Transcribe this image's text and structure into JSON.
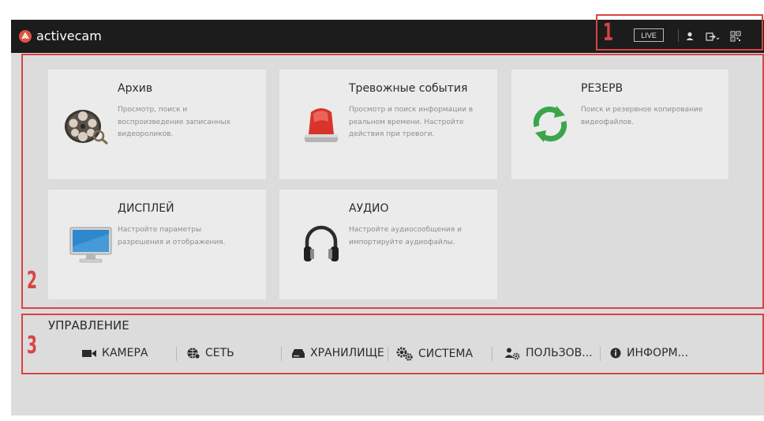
{
  "app": {
    "brand": "activecam"
  },
  "topbar": {
    "live_label": "LIVE"
  },
  "tiles": [
    {
      "title": "Архив",
      "desc": [
        "Просмотр, поиск и",
        "воспроизведение записанных",
        "видеороликов."
      ]
    },
    {
      "title": "Тревожные события",
      "desc": [
        "Просмотр и поиск информации в",
        "реальном времени. Настройте",
        "действия при тревоги."
      ]
    },
    {
      "title": "РЕЗЕРВ",
      "desc": [
        "Поиск и резервное копирование",
        "видеофайлов."
      ]
    },
    {
      "title": "ДИСПЛЕЙ",
      "desc": [
        "Настройте параметры",
        "разрешения и отображения."
      ]
    },
    {
      "title": "АУДИО",
      "desc": [
        "Настройте аудиосообщения и",
        "импортируйте аудиофайлы."
      ]
    }
  ],
  "management": {
    "title": "УПРАВЛЕНИЕ",
    "items": [
      {
        "label": "КАМЕРА",
        "icon": "camera-icon"
      },
      {
        "label": "СЕТЬ",
        "icon": "network-icon"
      },
      {
        "label": "ХРАНИЛИЩЕ",
        "icon": "storage-icon"
      },
      {
        "label": "СИСТЕМА",
        "icon": "gears-icon"
      },
      {
        "label": "ПОЛЬЗОВ...",
        "icon": "users-icon"
      },
      {
        "label": "ИНФОРМ...",
        "icon": "info-icon"
      }
    ]
  },
  "annotations": {
    "one": "1",
    "two": "2",
    "three": "3"
  },
  "colors": {
    "topbar": "#1c1c1c",
    "background": "#dcdcdc",
    "tile": "#ebebeb",
    "annotation": "#d84444",
    "brand": "#e0533d"
  }
}
